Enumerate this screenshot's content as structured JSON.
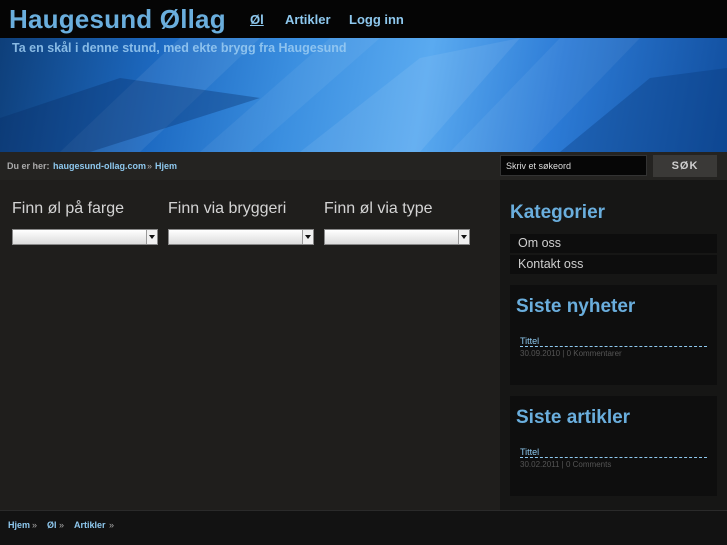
{
  "header": {
    "site_title": "Haugesund Øllag",
    "nav": [
      "Øl",
      "Artikler",
      "Logg inn"
    ],
    "tagline": "Ta en skål i denne stund, med ekte brygg fra Haugesund"
  },
  "breadcrumb": {
    "prefix": "Du er her:",
    "site": "haugesund-ollag.com",
    "separator": "»",
    "current": "Hjem"
  },
  "search": {
    "placeholder": "Skriv et søkeord",
    "button": "SØK"
  },
  "finders": [
    {
      "label": "Finn øl på farge",
      "selected": ""
    },
    {
      "label": "Finn via bryggeri",
      "selected": ""
    },
    {
      "label": "Finn øl via type",
      "selected": ""
    }
  ],
  "sidebar": {
    "kategorier_title": "Kategorier",
    "kategorier": [
      "Om oss",
      "Kontakt oss"
    ],
    "nyheter": {
      "title": "Siste nyheter",
      "link": "Tittel",
      "meta": "30.09.2010 | 0 Kommentarer"
    },
    "artikler": {
      "title": "Siste artikler",
      "link": "Tittel",
      "meta": "30.02.2011 | 0 Comments"
    }
  },
  "footer": {
    "links": [
      "Hjem",
      "Øl",
      "Artikler"
    ],
    "separator": "»"
  },
  "colors": {
    "accent": "#6aaedd",
    "link": "#8ec8ee",
    "background": "#1f1e1c"
  }
}
